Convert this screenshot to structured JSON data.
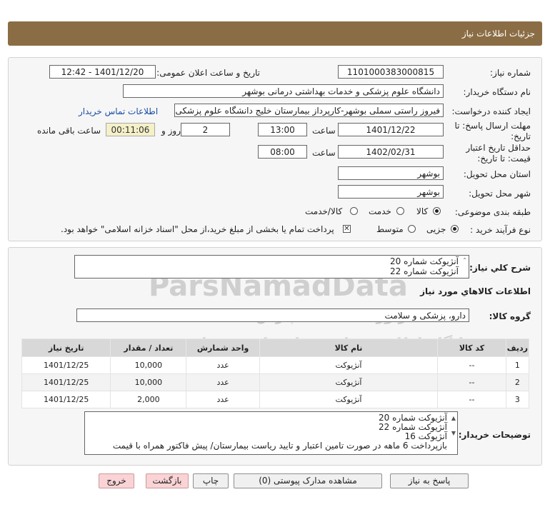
{
  "title": "جزئیات اطلاعات نیاز",
  "fields": {
    "need_number_label": "شماره نیاز:",
    "need_number": "1101000383000815",
    "announce_label": "تاریخ و ساعت اعلان عمومی:",
    "announce_value": "1401/12/20 - 12:42",
    "buyer_org_label": "نام دستگاه خریدار:",
    "buyer_org": "دانشگاه علوم پزشکی و خدمات بهداشتی درمانی بوشهر",
    "requester_label": "ایجاد کننده درخواست:",
    "requester": "فیروز راستی سملی بوشهر-کارپرداز بیمارستان خلیج دانشگاه علوم پزشکی و خ",
    "contact_link": "اطلاعات تماس خریدار",
    "deadline_label_1": "مهلت ارسال پاسخ: تا",
    "deadline_label_2": "تاریخ:",
    "deadline_date": "1401/12/22",
    "time_label": "ساعت",
    "deadline_time": "13:00",
    "days_value": "2",
    "days_label": "روز و",
    "remaining_time": "00:11:06",
    "remaining_label": "ساعت باقی مانده",
    "validity_label_1": "حداقل تاریخ اعتبار",
    "validity_label_2": "قیمت: تا تاریخ:",
    "validity_date": "1402/02/31",
    "validity_time_label": "ساعت",
    "validity_time": "08:00",
    "province_label": "استان محل تحویل:",
    "province": "بوشهر",
    "city_label": "شهر محل تحویل:",
    "city": "بوشهر",
    "category_label": "طبقه بندی موضوعی:",
    "category_options": [
      "کالا",
      "خدمت",
      "کالا/خدمت"
    ],
    "process_label": "نوع فرآیند خرید :",
    "process_options": [
      "جزیی",
      "متوسط"
    ],
    "payment_note": "پرداخت تمام یا بخشی از مبلغ خرید،از محل \"اسناد خزانه اسلامی\" خواهد بود."
  },
  "summary": {
    "label": "شرح کلي نياز:",
    "lines": [
      "آنژیوکت شماره 20",
      "آنژیوکت شماره 22"
    ]
  },
  "goods_info_label": "اطلاعات کالاهاي مورد نياز",
  "goods_group_label": "گروه کالا:",
  "goods_group": "دارو، پزشکی و سلامت",
  "table": {
    "headers": [
      "ردیف",
      "کد کالا",
      "نام کالا",
      "واحد شمارش",
      "تعداد / مقدار",
      "تاریخ نیاز"
    ],
    "rows": [
      [
        "1",
        "--",
        "آنژیوکت",
        "عدد",
        "10,000",
        "1401/12/25"
      ],
      [
        "2",
        "--",
        "آنژیوکت",
        "عدد",
        "10,000",
        "1401/12/25"
      ],
      [
        "3",
        "--",
        "آنژیوکت",
        "عدد",
        "2,000",
        "1401/12/25"
      ]
    ]
  },
  "buyer_notes": {
    "label": "توضیحات خریدار:",
    "lines": [
      "آنژیوکت شماره 20",
      "آنژیوکت شماره 22",
      "آنژیوکت 16",
      "بازپرداخت 6 ماهه در صورت تامین اعتبار و تایید ریاست بیمارستان/ پیش فاکتور همراه با قیمت"
    ]
  },
  "buttons": {
    "reply": "پاسخ به نیاز",
    "attachments": "مشاهده مدارک پیوستی (0)",
    "print": "چاپ",
    "back": "بازگشت",
    "exit": "خروج"
  },
  "watermark": {
    "brand": "ParsNamadData",
    "line1": "پایگاه اطلاع رسانی مناقصات و مزایده",
    "phone": "۰۲۱-۸۸۳۴۹۶۷۰-۵",
    "line2": "فراوری اطلاعات پارس نماد داده ها"
  }
}
